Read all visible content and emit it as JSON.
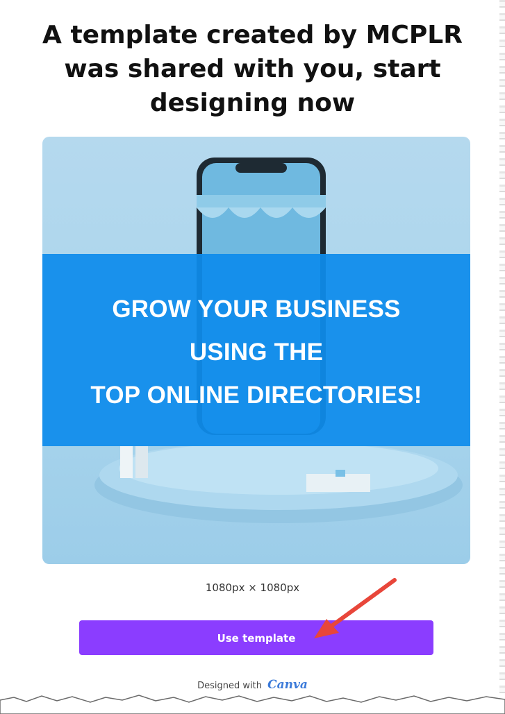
{
  "header": {
    "title_line1": "A template created by MCPLR",
    "title_line2": "was shared with you, start",
    "title_line3": "designing now"
  },
  "preview": {
    "headline_line1": "GROW YOUR BUSINESS",
    "headline_line2": "USING THE",
    "headline_line3": "TOP ONLINE DIRECTORIES!"
  },
  "dimensions_label": "1080px × 1080px",
  "use_template_button": "Use template",
  "footer": {
    "designed_with": "Designed with",
    "brand": "Canva"
  },
  "colors": {
    "button": "#8b3dff",
    "banner": "#0e8cec",
    "arrow": "#e8463a",
    "brand": "#3b7ad9"
  }
}
